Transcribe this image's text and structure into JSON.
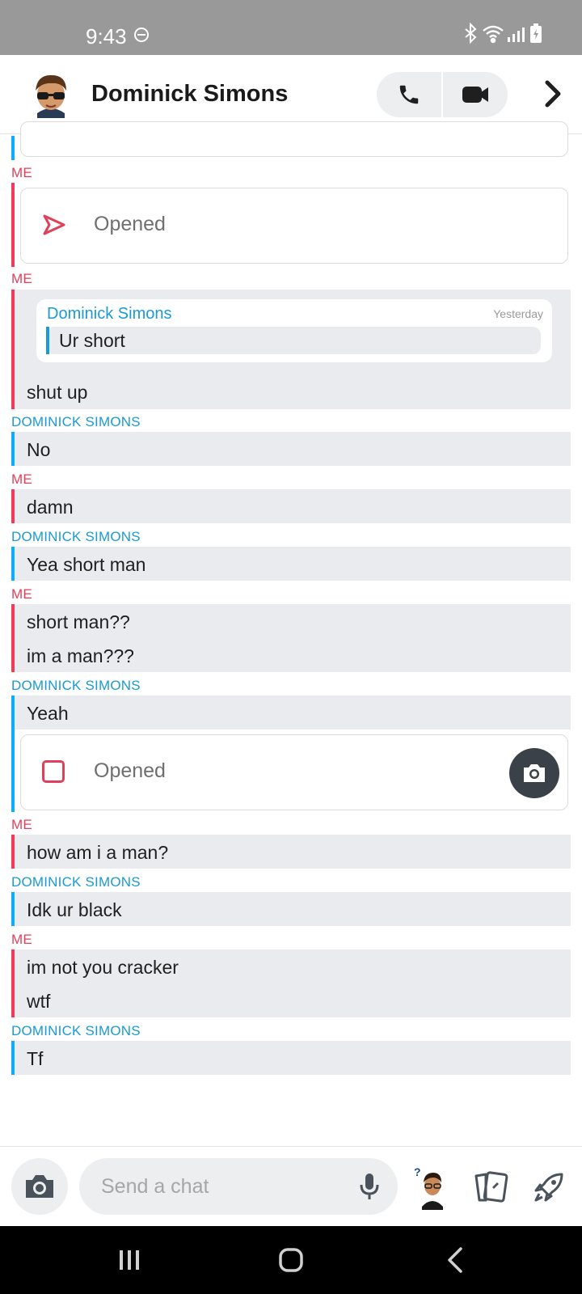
{
  "status_bar": {
    "time": "9:43"
  },
  "header": {
    "contact_name": "Dominick Simons"
  },
  "messages": {
    "opened_sent": "Opened",
    "quote": {
      "name": "Dominick Simons",
      "time": "Yesterday",
      "text": "Ur short"
    },
    "m1": "shut up",
    "m2": "No",
    "m3": "damn",
    "m4": "Yea short man",
    "m5": "short man??",
    "m6": "im a man???",
    "m7": "Yeah",
    "opened_snap": "Opened",
    "m8": "how am i a man?",
    "m9": "Idk ur black",
    "m10": "im not you cracker",
    "m11": "wtf",
    "m12": "Tf"
  },
  "senders": {
    "me": "ME",
    "them": "DOMINICK SIMONS"
  },
  "composer": {
    "placeholder": "Send a chat"
  },
  "colors": {
    "me": "#f23c57",
    "them": "#0fadff",
    "bubble": "#e9ebee"
  }
}
